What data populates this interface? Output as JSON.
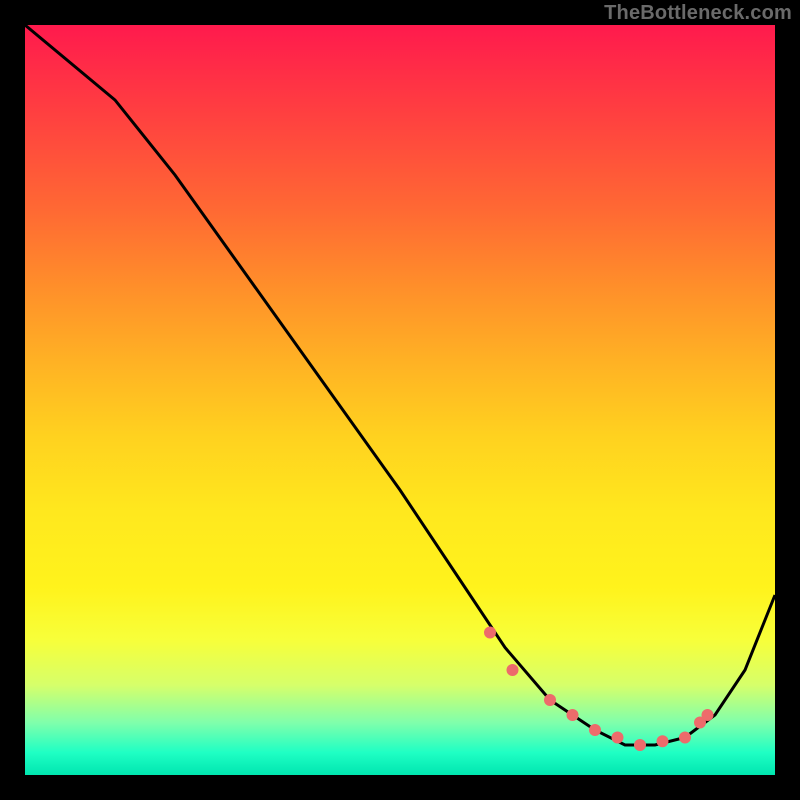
{
  "watermark": "TheBottleneck.com",
  "chart_data": {
    "type": "line",
    "title": "",
    "xlabel": "",
    "ylabel": "",
    "xlim": [
      0,
      100
    ],
    "ylim": [
      0,
      100
    ],
    "grid": false,
    "legend": false,
    "series": [
      {
        "name": "bottleneck-curve",
        "color": "#000000",
        "x": [
          0,
          6,
          12,
          20,
          30,
          40,
          50,
          58,
          64,
          70,
          76,
          80,
          84,
          88,
          92,
          96,
          100
        ],
        "values": [
          100,
          95,
          90,
          80,
          66,
          52,
          38,
          26,
          17,
          10,
          6,
          4,
          4,
          5,
          8,
          14,
          24
        ]
      }
    ],
    "markers": {
      "name": "highlight-dots",
      "color": "#ed6b6b",
      "radius": 6,
      "points": [
        {
          "x": 62,
          "y": 19
        },
        {
          "x": 65,
          "y": 14
        },
        {
          "x": 70,
          "y": 10
        },
        {
          "x": 73,
          "y": 8
        },
        {
          "x": 76,
          "y": 6
        },
        {
          "x": 79,
          "y": 5
        },
        {
          "x": 82,
          "y": 4
        },
        {
          "x": 85,
          "y": 4.5
        },
        {
          "x": 88,
          "y": 5
        },
        {
          "x": 90,
          "y": 7
        },
        {
          "x": 91,
          "y": 8
        }
      ]
    }
  }
}
